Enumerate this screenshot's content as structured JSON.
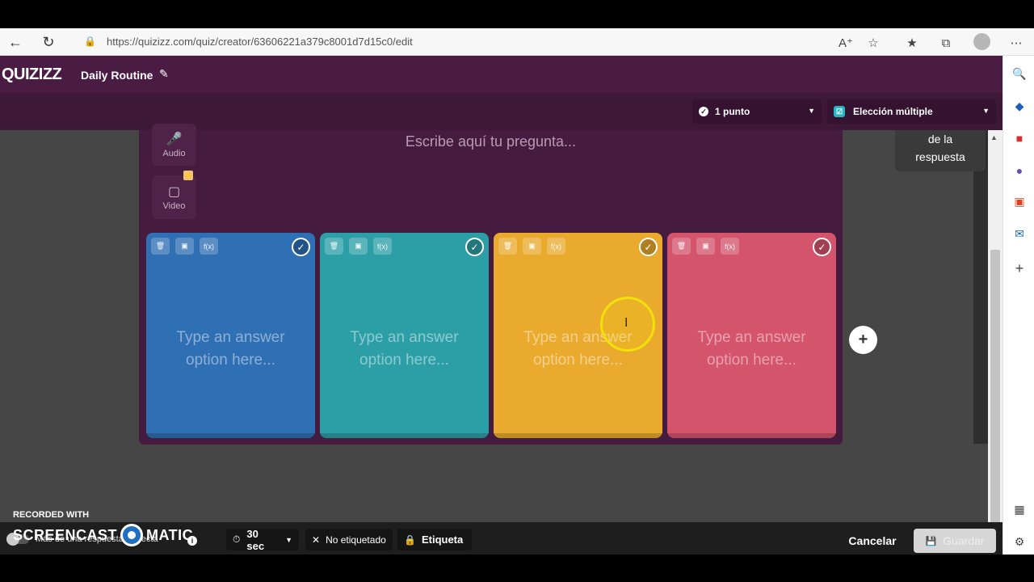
{
  "browser": {
    "url": "https://quizizz.com/quiz/creator/63606221a379c8001d7d15c0/edit"
  },
  "app": {
    "logo": "QUIZIZZ",
    "quiz_title": "Daily Routine",
    "points_select": "1 punto",
    "type_select": "Elección múltiple",
    "media": {
      "audio_label": "Audio",
      "video_label": "Video"
    },
    "question_placeholder": "Escribe aquí tu pregunta...",
    "answers": [
      {
        "placeholder": "Type an answer option here...",
        "color": "#2f6fb3"
      },
      {
        "placeholder": "Type an answer option here...",
        "color": "#2c9fa6"
      },
      {
        "placeholder": "Type an answer option here...",
        "color": "#eaaa2e"
      },
      {
        "placeholder": "Type an answer option here...",
        "color": "#d4546c"
      }
    ],
    "tool_labels": {
      "formula": "f(x)"
    },
    "tooltip": {
      "line1": "de la",
      "line2": "respuesta"
    }
  },
  "bottom": {
    "multi_correct_label": "Más de una respuesta correcta",
    "timer": "30 sec",
    "tag_status": "No etiquetado",
    "tag_button": "Etiqueta",
    "cancel": "Cancelar",
    "save": "Guardar"
  },
  "watermark": {
    "recorded_with": "RECORDED WITH",
    "brand_left": "SCREENCAST",
    "brand_right": "MATIC"
  }
}
